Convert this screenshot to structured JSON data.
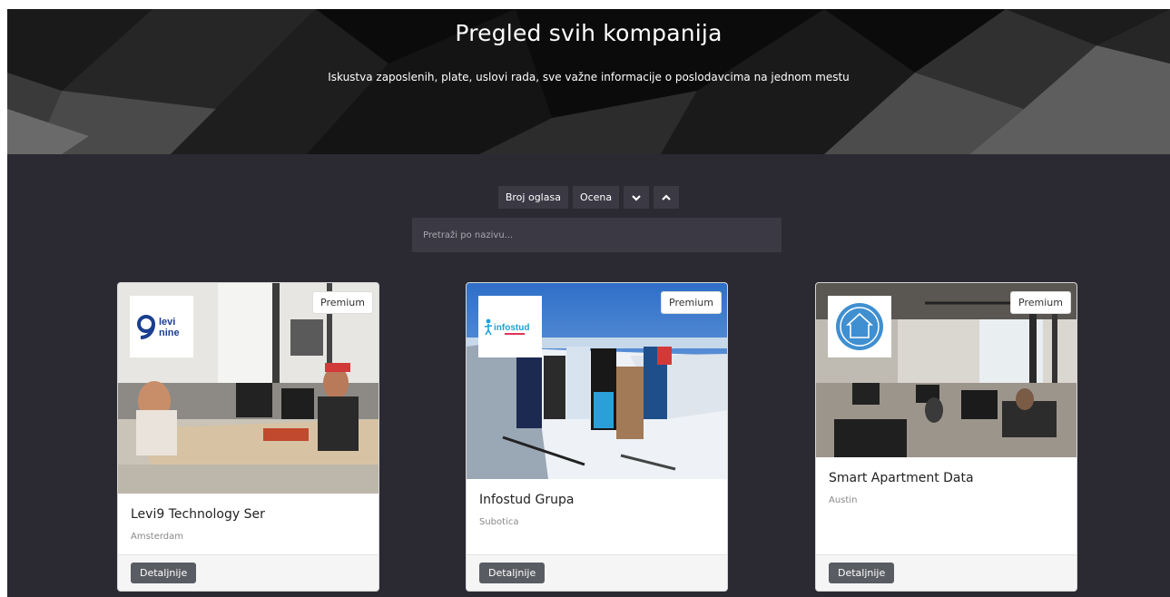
{
  "hero": {
    "title": "Pregled svih kompanija",
    "subtitle": "Iskustva zaposlenih, plate, uslovi rada, sve važne informacije o poslodavcima na jednom mestu"
  },
  "sort": {
    "by_ads_label": "Broj oglasa",
    "by_rating_label": "Ocena",
    "desc_icon": "chevron-down-icon",
    "asc_icon": "chevron-up-icon"
  },
  "search": {
    "placeholder": "Pretraži po nazivu..."
  },
  "companies": [
    {
      "name": "Levi9 Technology Ser",
      "city": "Amsterdam",
      "badge": "Premium",
      "details_label": "Detaljnije",
      "logo_text_1": "levi",
      "logo_text_2": "nine"
    },
    {
      "name": "Infostud Grupa",
      "city": "Subotica",
      "badge": "Premium",
      "details_label": "Detaljnije",
      "logo_text": "infostud"
    },
    {
      "name": "Smart Apartment Data",
      "city": "Austin",
      "badge": "Premium",
      "details_label": "Detaljnije"
    }
  ],
  "colors": {
    "page_bg": "#2b2a33",
    "control_bg": "#3a3944",
    "details_button": "#5a5c63",
    "levi9_blue": "#1b3f91",
    "infostud_blue": "#1aa3dc"
  }
}
